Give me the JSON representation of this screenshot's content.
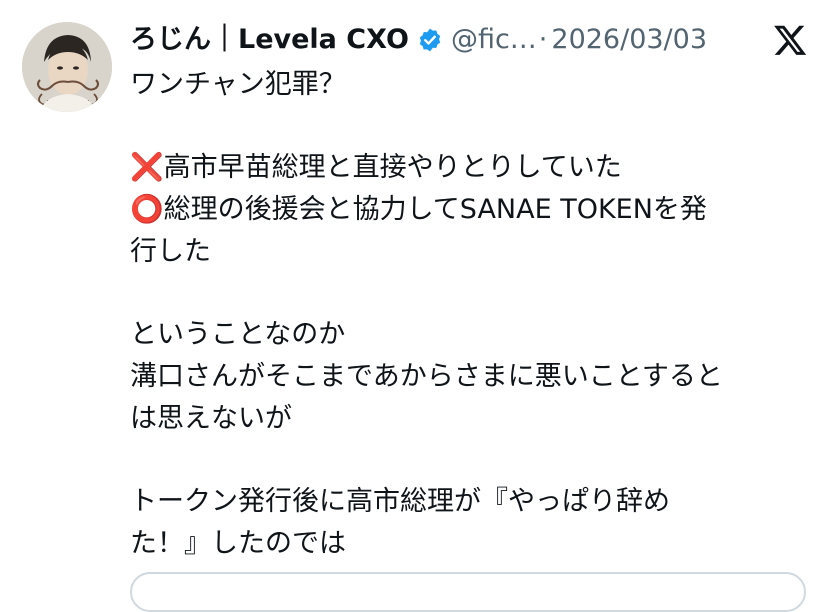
{
  "tweet": {
    "display_name": "ろじん｜Levela CXO",
    "handle": "@fic…",
    "separator": "·",
    "date": "2026/03/03",
    "text": "ワンチャン犯罪？\n\n❌高市早苗総理と直接やりとりしていた\n⭕総理の後援会と協力してSANAE TOKENを発\n行した\n\nということなのか\n溝口さんがそこまであからさまに悪いことすると\nは思えないが\n\nトークン発行後に高市総理が『やっぱり辞め\nた！』したのでは"
  },
  "icons": {
    "verified": "verified-badge-icon",
    "brand": "x-logo-icon",
    "cross_color": "#e0245e",
    "circle_color": "#e0245e",
    "badge_color": "#1d9bf0"
  }
}
